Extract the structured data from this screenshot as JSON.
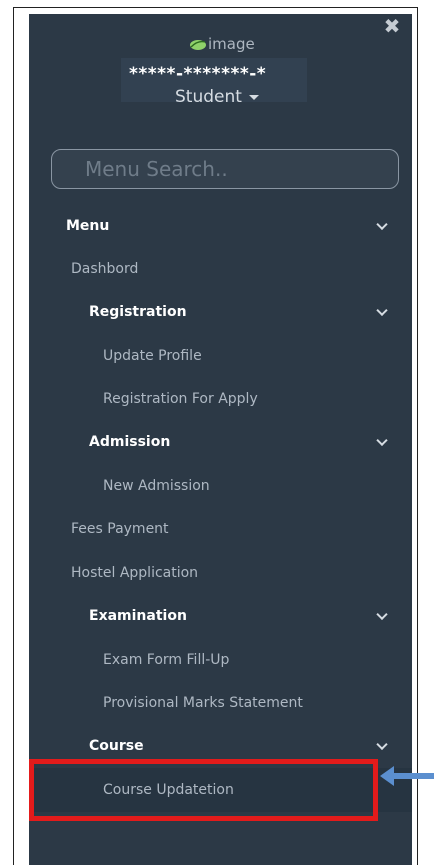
{
  "sidebar": {
    "close_glyph": "✖",
    "avatar_alt": "image",
    "user_name": "*****-*******-*",
    "role": "Student",
    "search": {
      "placeholder": "Menu Search.."
    },
    "menu": [
      {
        "label": "Menu",
        "kind": "head",
        "expanded": true
      },
      {
        "label": "Dashbord",
        "kind": "item"
      },
      {
        "label": "Registration",
        "kind": "head",
        "expanded": true
      },
      {
        "label": "Update Profile",
        "kind": "sub"
      },
      {
        "label": "Registration For Apply",
        "kind": "sub"
      },
      {
        "label": "Admission",
        "kind": "head",
        "expanded": true
      },
      {
        "label": "New Admission",
        "kind": "sub"
      },
      {
        "label": "Fees Payment",
        "kind": "item"
      },
      {
        "label": "Hostel Application",
        "kind": "item"
      },
      {
        "label": "Examination",
        "kind": "head",
        "expanded": true
      },
      {
        "label": "Exam Form Fill-Up",
        "kind": "sub"
      },
      {
        "label": "Provisional Marks Statement",
        "kind": "sub"
      },
      {
        "label": "Course",
        "kind": "head",
        "expanded": true
      },
      {
        "label": "Course Updatetion",
        "kind": "sub",
        "highlighted": true
      }
    ]
  },
  "colors": {
    "sidebar_bg": "#2c3946",
    "highlight": "#e31b1b",
    "arrow": "#5b8fcf"
  },
  "icons": {
    "close": "close-icon",
    "chevron": "chevron-down-icon",
    "avatar": "leaf-image-icon",
    "pointer": "arrow-left-icon"
  }
}
